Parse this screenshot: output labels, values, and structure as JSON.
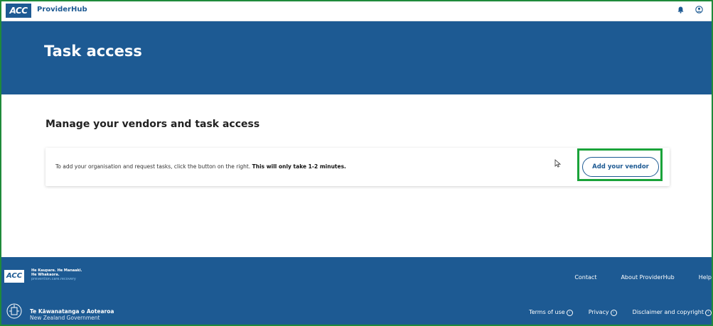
{
  "header": {
    "logo_text": "ACC",
    "app_name": "ProviderHub"
  },
  "hero": {
    "title": "Task access"
  },
  "main": {
    "section_title": "Manage your vendors and task access",
    "card": {
      "text": "To add your organisation and request tasks, click the button on the right.",
      "text_bold": "This will only take 1-2 minutes.",
      "button_label": "Add your vendor"
    }
  },
  "footer": {
    "logo_text": "ACC",
    "tagline_1": "He Kaupare. He Manaaki.",
    "tagline_2": "He Whakaora.",
    "tagline_3": "prevention.care.recovery",
    "links": [
      "Contact",
      "About ProviderHub",
      "Help"
    ],
    "gov_name_1": "Te Kāwanatanga o Aotearoa",
    "gov_name_2": "New Zealand Government",
    "bottom_links": [
      "Terms of use",
      "Privacy",
      "Disclaimer and copyright"
    ]
  },
  "colors": {
    "brand": "#1d5a93",
    "highlight": "#1aa33a"
  }
}
